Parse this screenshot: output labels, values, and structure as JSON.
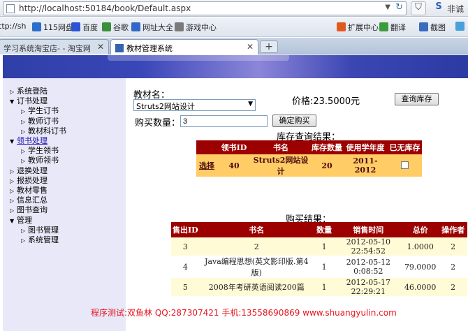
{
  "browser": {
    "url": "http://localhost:50184/book/Default.aspx",
    "search_text": "非诚",
    "favorites": [
      {
        "label": "ttp://sh",
        "color": "#ffffff"
      },
      {
        "label": "115网盘",
        "color": "#2a6fc9"
      },
      {
        "label": "百度",
        "color": "#2b53d4"
      },
      {
        "label": "谷歌",
        "color": "#3c8f3c"
      },
      {
        "label": "网址大全",
        "color": "#3468c8"
      },
      {
        "label": "游戏中心",
        "color": "#7a7a7a"
      },
      {
        "label": "扩展中心",
        "color": "#e05a20"
      },
      {
        "label": "翻译",
        "color": "#3c9c3c"
      },
      {
        "label": "截图",
        "color": "#3a6bbd"
      }
    ],
    "tabs": [
      {
        "label": "学习系统淘宝店- - 淘宝网"
      },
      {
        "label": "教材管理系统"
      }
    ]
  },
  "nav": [
    {
      "label": "系统登陆",
      "expanded": false,
      "level": 0,
      "link": false
    },
    {
      "label": "订书处理",
      "expanded": true,
      "level": 0,
      "link": false
    },
    {
      "label": "学生订书",
      "expanded": false,
      "level": 1,
      "link": false
    },
    {
      "label": "教师订书",
      "expanded": false,
      "level": 1,
      "link": false
    },
    {
      "label": "教材科订书",
      "expanded": false,
      "level": 1,
      "link": false
    },
    {
      "label": "领书处理",
      "expanded": true,
      "level": 0,
      "link": true
    },
    {
      "label": "学生领书",
      "expanded": false,
      "level": 1,
      "link": false
    },
    {
      "label": "教师领书",
      "expanded": false,
      "level": 1,
      "link": false
    },
    {
      "label": "退换处理",
      "expanded": false,
      "level": 0,
      "link": false
    },
    {
      "label": "报损处理",
      "expanded": false,
      "level": 0,
      "link": false
    },
    {
      "label": "教材零售",
      "expanded": false,
      "level": 0,
      "link": false
    },
    {
      "label": "信息汇总",
      "expanded": false,
      "level": 0,
      "link": false
    },
    {
      "label": "图书查询",
      "expanded": false,
      "level": 0,
      "link": false
    },
    {
      "label": "管理",
      "expanded": true,
      "level": 0,
      "link": false
    },
    {
      "label": "图书管理",
      "expanded": false,
      "level": 1,
      "link": false
    },
    {
      "label": "系统管理",
      "expanded": false,
      "level": 1,
      "link": false
    }
  ],
  "form": {
    "book_name_label": "教材名：",
    "book_selected": "Struts2网站设计",
    "price_text": "价格:23.5000元",
    "query_button": "查询库存",
    "qty_label": "购买数量：",
    "qty_value": "3",
    "buy_button": "确定购买"
  },
  "stock": {
    "title": "库存查询结果：",
    "headers": [
      "",
      "领书ID",
      "书名",
      "库存数量",
      "使用学年度",
      "已无库存"
    ],
    "rows": [
      {
        "select": "选择",
        "id": "40",
        "name": "Struts2网站设计",
        "qty": "20",
        "year": "2011-2012",
        "out": false
      }
    ]
  },
  "sales": {
    "title": "购买结果：",
    "headers": [
      "售出ID",
      "书名",
      "数量",
      "销售时间",
      "总价",
      "操作者"
    ],
    "rows": [
      {
        "id": "3",
        "name": "2",
        "qty": "1",
        "time": "2012-05-10 22:54:52",
        "total": "1.0000",
        "op": "2"
      },
      {
        "id": "4",
        "name": "Java编程思想(英文影印版.第4版)",
        "qty": "1",
        "time": "2012-05-12 0:08:52",
        "total": "79.0000",
        "op": "2"
      },
      {
        "id": "5",
        "name": "2008年考研英语阅读200篇",
        "qty": "1",
        "time": "2012-05-17 22:29:21",
        "total": "46.0000",
        "op": "2"
      }
    ]
  },
  "footer": "程序测试:双鱼林 QQ:287307421 手机:13558690869 www.shuangyulin.com"
}
